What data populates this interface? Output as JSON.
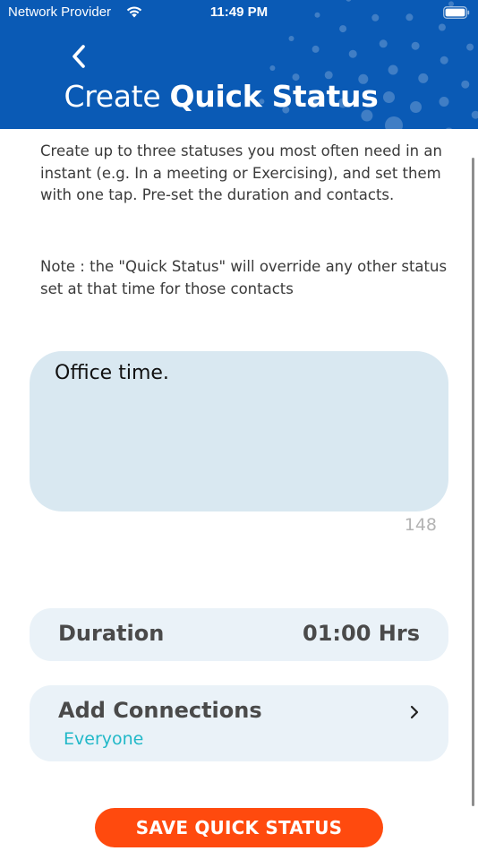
{
  "status_bar": {
    "carrier": "Network Provider",
    "time": "11:49 PM"
  },
  "header": {
    "title_light": "Create",
    "title_bold": "Quick Status",
    "background_color": "#0a5ab5"
  },
  "description": "Create up to three statuses you most often need in an instant (e.g. In a meeting or Exercising), and set them with one tap. Pre-set the duration and contacts.",
  "note": "Note : the \"Quick Status\" will override any other status set at that time for those contacts",
  "status_input": {
    "value": "Office time.",
    "remaining_chars": "148"
  },
  "duration": {
    "label": "Duration",
    "value": "01:00 Hrs"
  },
  "connections": {
    "label": "Add Connections",
    "selected": "Everyone"
  },
  "save_button": {
    "label": "SAVE QUICK STATUS",
    "color": "#ff4a0e"
  },
  "icons": [
    "wifi-icon",
    "battery-icon",
    "back-arrow-icon",
    "chevron-right-icon"
  ]
}
